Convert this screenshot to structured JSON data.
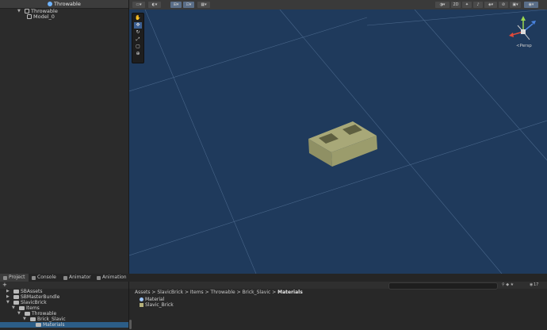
{
  "hierarchy": {
    "title": "Throwable",
    "items": [
      {
        "label": "Throwable"
      },
      {
        "label": "Model_0"
      }
    ]
  },
  "scene": {
    "persp_label": "<Persp",
    "toolbar_2d": "2D"
  },
  "bottom": {
    "tabs": [
      {
        "label": "Project"
      },
      {
        "label": "Console"
      },
      {
        "label": "Animator"
      },
      {
        "label": "Animation"
      }
    ],
    "plus_label": "+",
    "count_label": "17",
    "tree": [
      {
        "label": "SBAssets"
      },
      {
        "label": "SBMasterBundle"
      },
      {
        "label": "SlavicBrick"
      },
      {
        "label": "Items"
      },
      {
        "label": "Throwable"
      },
      {
        "label": "Brick_Slavic"
      },
      {
        "label": "Materials"
      }
    ],
    "breadcrumb": {
      "path": "Assets > SlavicBrick > Items > Throwable > Brick_Slavic > ",
      "current": "Materials"
    },
    "assets": [
      {
        "label": "Material"
      },
      {
        "label": "Slavic_Brick"
      }
    ]
  },
  "colors": {
    "scene_bg": "#1f3a5c",
    "selection": "#2c5d87",
    "brick": "#9b9c6c"
  }
}
